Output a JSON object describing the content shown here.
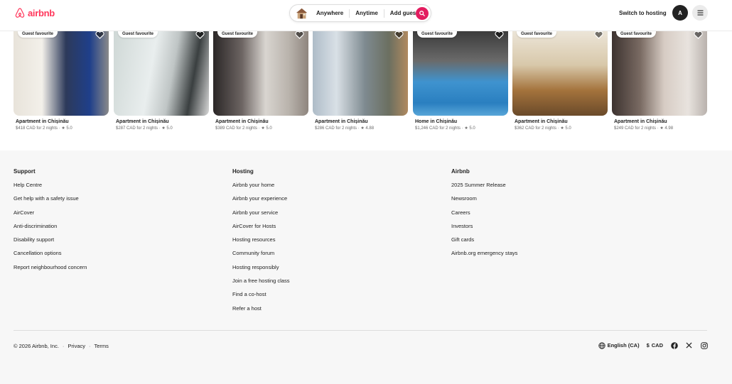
{
  "header": {
    "brand": "airbnb",
    "search": {
      "where": "Anywhere",
      "when": "Anytime",
      "who": "Add guests"
    },
    "switch_to_hosting": "Switch to hosting",
    "avatar_initial": "A"
  },
  "listings": [
    {
      "badge": "Guest favourite",
      "title": "Apartment in Chișinău",
      "meta": "$418 CAD for 2 nights · ★ 5.0"
    },
    {
      "badge": "Guest favourite",
      "title": "Apartment in Chișinău",
      "meta": "$287 CAD for 2 nights · ★ 5.0"
    },
    {
      "badge": "Guest favourite",
      "title": "Apartment in Chișinău",
      "meta": "$389 CAD for 2 nights · ★ 5.0"
    },
    {
      "badge": "",
      "title": "Apartment in Chișinău",
      "meta": "$286 CAD for 2 nights · ★ 4.88"
    },
    {
      "badge": "Guest favourite",
      "title": "Home in Chișinău",
      "meta": "$1,246 CAD for 2 nights · ★ 5.0"
    },
    {
      "badge": "Guest favourite",
      "title": "Apartment in Chișinău",
      "meta": "$362 CAD for 2 nights · ★ 5.0"
    },
    {
      "badge": "Guest favourite",
      "title": "Apartment in Chișinău",
      "meta": "$249 CAD for 2 nights · ★ 4.98"
    }
  ],
  "footer": {
    "support": {
      "heading": "Support",
      "links": [
        "Help Centre",
        "Get help with a safety issue",
        "AirCover",
        "Anti-discrimination",
        "Disability support",
        "Cancellation options",
        "Report neighbourhood concern"
      ]
    },
    "hosting": {
      "heading": "Hosting",
      "links": [
        "Airbnb your home",
        "Airbnb your experience",
        "Airbnb your service",
        "AirCover for Hosts",
        "Hosting resources",
        "Community forum",
        "Hosting responsibly",
        "Join a free hosting class",
        "Find a co-host",
        "Refer a host"
      ]
    },
    "airbnb": {
      "heading": "Airbnb",
      "links": [
        "2025 Summer Release",
        "Newsroom",
        "Careers",
        "Investors",
        "Gift cards",
        "Airbnb.org emergency stays"
      ]
    },
    "copyright": "© 2026 Airbnb, Inc.",
    "privacy": "Privacy",
    "terms": "Terms",
    "language": "English (CA)",
    "currency_symbol": "$",
    "currency": "CAD"
  },
  "colors": {
    "brand": "#ff385c",
    "search_button": "#e31c5f"
  },
  "icons": [
    "airbnb-logo-icon",
    "house-icon",
    "search-icon",
    "hamburger-menu-icon",
    "heart-icon",
    "globe-icon",
    "facebook-icon",
    "x-icon",
    "instagram-icon"
  ]
}
